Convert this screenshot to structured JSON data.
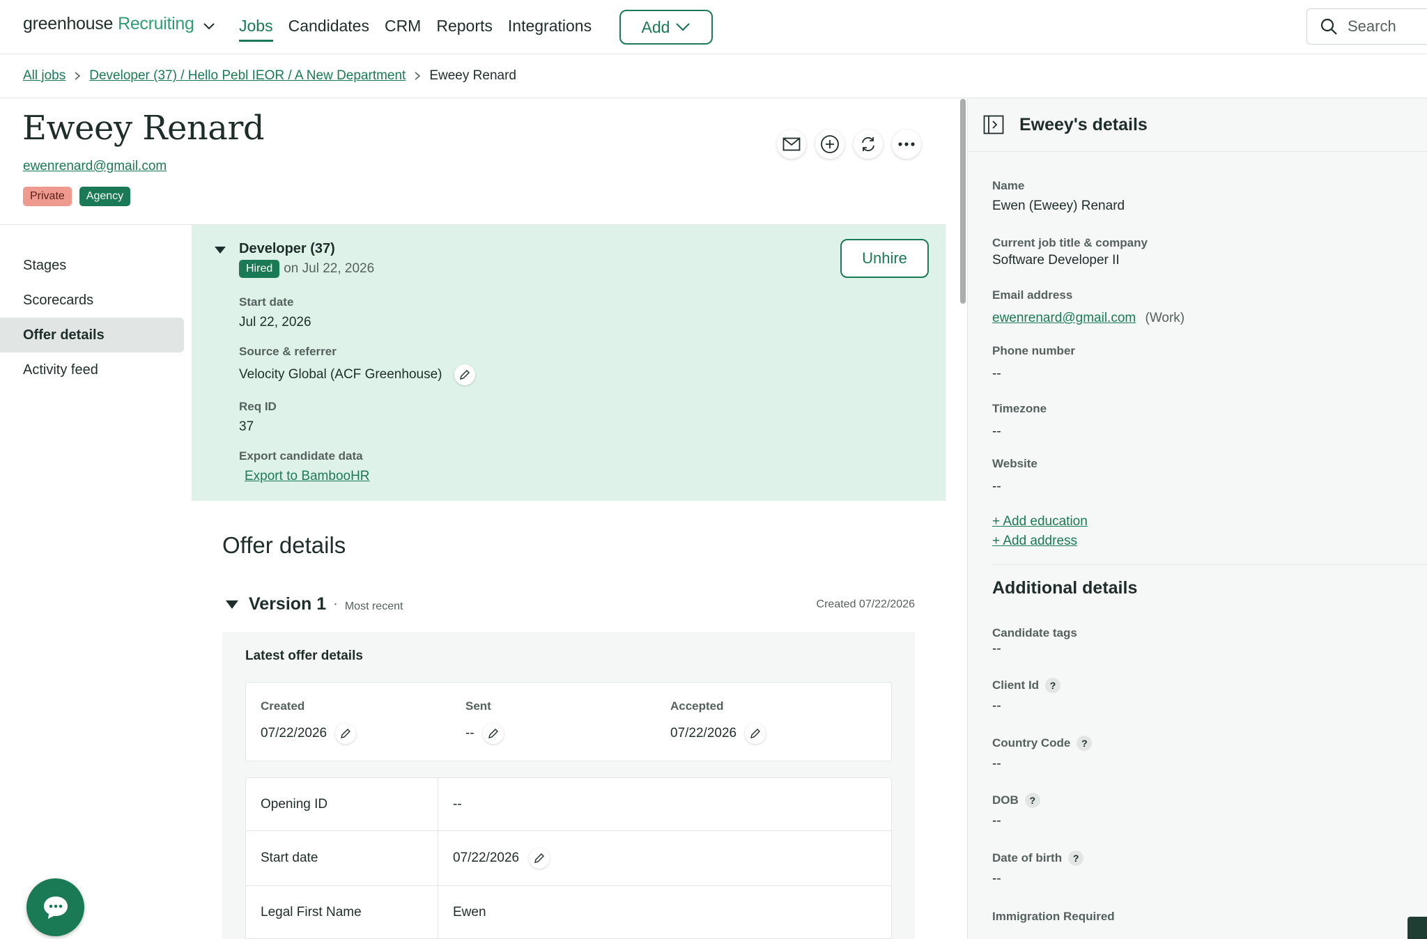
{
  "nav": {
    "logo_main": "greenhouse",
    "logo_sub": "Recruiting",
    "links": [
      "Jobs",
      "Candidates",
      "CRM",
      "Reports",
      "Integrations"
    ],
    "active": "Jobs",
    "add_label": "Add",
    "search_placeholder": "Search"
  },
  "breadcrumb": {
    "all_jobs": "All jobs",
    "job": "Developer (37) / Hello Pebl IEOR / A New Department",
    "current": "Eweey Renard"
  },
  "candidate": {
    "name": "Eweey Renard",
    "email": "ewenrenard@gmail.com",
    "tags": [
      "Private",
      "Agency"
    ]
  },
  "sidemenu": {
    "items": [
      "Stages",
      "Scorecards",
      "Offer details",
      "Activity feed"
    ],
    "active": "Offer details"
  },
  "job": {
    "title": "Developer (37)",
    "status": "Hired",
    "status_date": "on Jul 22, 2026",
    "unhire_label": "Unhire",
    "start_date_label": "Start date",
    "start_date": "Jul 22, 2026",
    "source_label": "Source & referrer",
    "source": "Velocity Global (ACF Greenhouse)",
    "req_label": "Req ID",
    "req_id": "37",
    "export_label": "Export candidate data",
    "export_link": "Export to BambooHR"
  },
  "offer": {
    "title": "Offer details",
    "version": "Version 1",
    "version_tag": "Most recent",
    "created": "Created 07/22/2026",
    "latest_title": "Latest offer details",
    "dates": {
      "created_label": "Created",
      "created": "07/22/2026",
      "sent_label": "Sent",
      "sent": "--",
      "accepted_label": "Accepted",
      "accepted": "07/22/2026"
    },
    "fields": [
      {
        "label": "Opening ID",
        "value": "--"
      },
      {
        "label": "Start date",
        "value": "07/22/2026"
      },
      {
        "label": "Legal First Name",
        "value": "Ewen"
      }
    ]
  },
  "details": {
    "title": "Eweey's details",
    "name_label": "Name",
    "name": "Ewen (Eweey) Renard",
    "job_label": "Current job title & company",
    "job": "Software Developer II",
    "email_label": "Email address",
    "email": "ewenrenard@gmail.com",
    "email_type": "(Work)",
    "phone_label": "Phone number",
    "phone": "--",
    "tz_label": "Timezone",
    "tz": "--",
    "web_label": "Website",
    "web": "--",
    "add_education": "+ Add education",
    "add_address": "+ Add address",
    "additional_title": "Additional details",
    "tags_label": "Candidate tags",
    "tags": "--",
    "client_label": "Client Id",
    "client": "--",
    "country_label": "Country Code",
    "country": "--",
    "dob_label": "DOB",
    "dob": "--",
    "birth_label": "Date of birth",
    "birth": "--",
    "immig_label": "Immigration Required"
  },
  "colors": {
    "brand": "#1a7a55",
    "panel": "#dff2ea",
    "private": "#ef9a8f"
  }
}
